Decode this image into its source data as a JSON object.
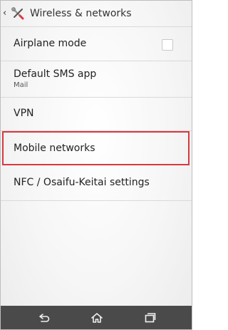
{
  "header": {
    "back_icon": "chevron-left-icon",
    "settings_icon": "tools-icon",
    "title": "Wireless & networks"
  },
  "settings": [
    {
      "label": "Airplane mode",
      "control": "checkbox",
      "checked": false
    },
    {
      "label": "Default SMS app",
      "subtitle": "Mail"
    },
    {
      "label": "VPN"
    },
    {
      "label": "Mobile networks",
      "highlighted": true
    },
    {
      "label": "NFC / Osaifu-Keitai settings"
    }
  ],
  "navbar": {
    "back_icon": "back-icon",
    "home_icon": "home-icon",
    "recents_icon": "recent-apps-icon"
  },
  "colors": {
    "highlight": "#d9383f",
    "navbar": "#4a4a4a",
    "text": "#222222"
  }
}
